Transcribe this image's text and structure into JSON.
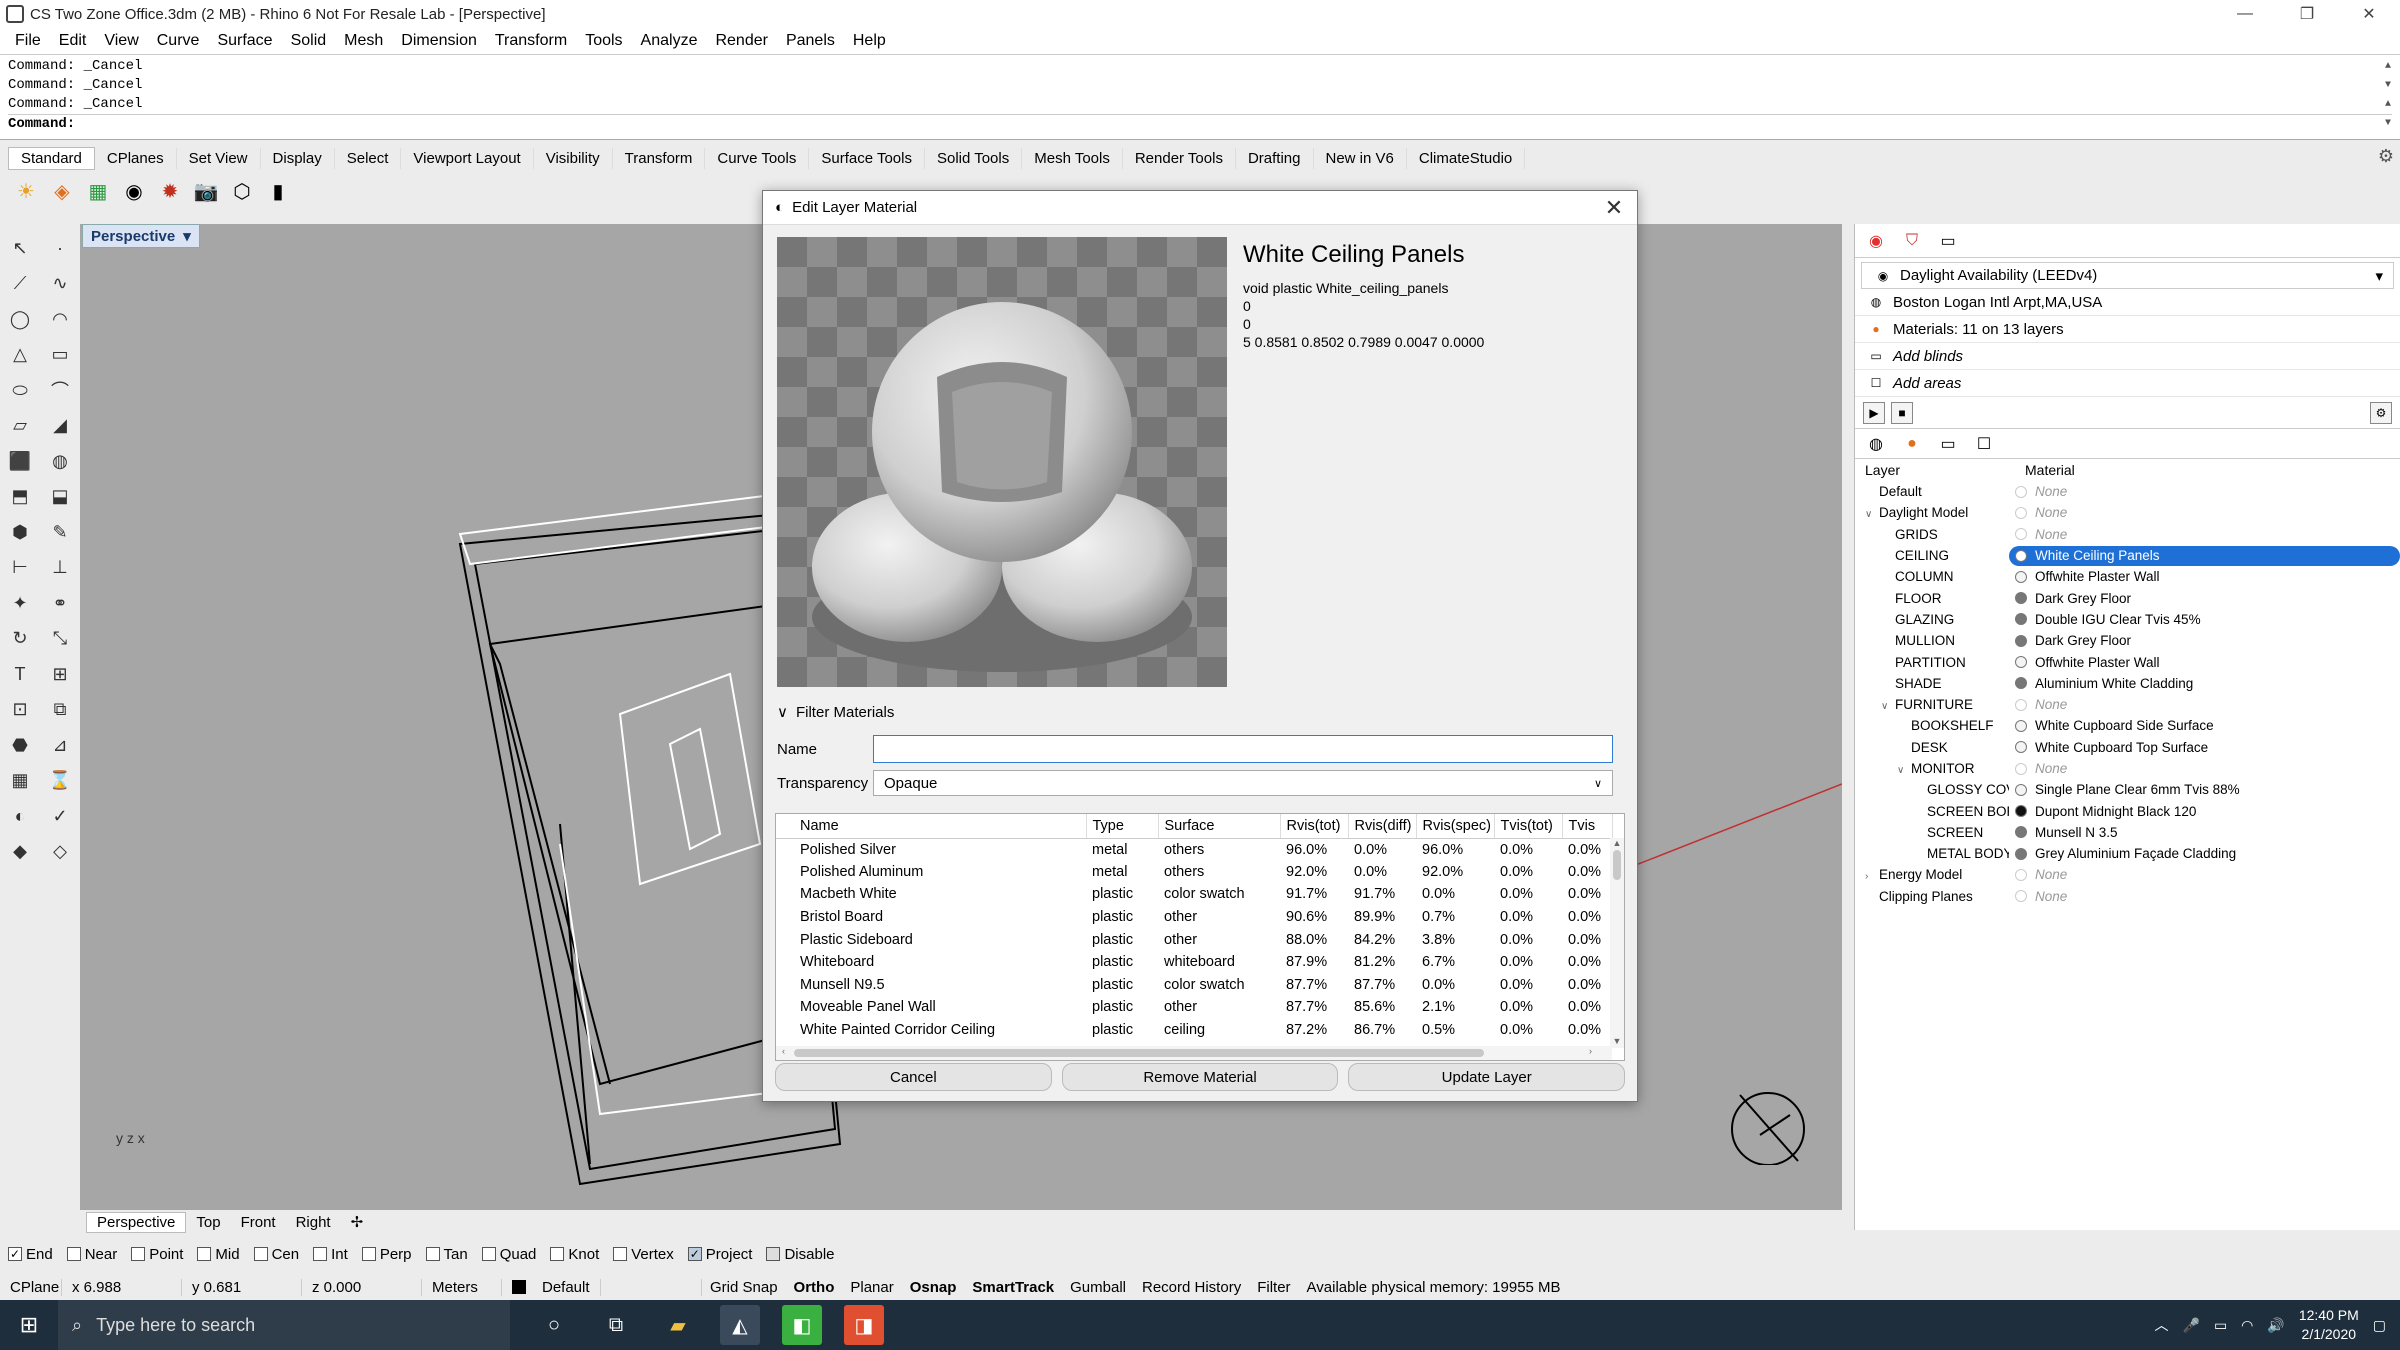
{
  "window": {
    "title": "CS Two Zone Office.3dm (2 MB) - Rhino 6 Not For Resale Lab - [Perspective]",
    "controls": [
      "—",
      "❐",
      "✕"
    ]
  },
  "menu": [
    "File",
    "Edit",
    "View",
    "Curve",
    "Surface",
    "Solid",
    "Mesh",
    "Dimension",
    "Transform",
    "Tools",
    "Analyze",
    "Render",
    "Panels",
    "Help"
  ],
  "command_history": [
    "Command: _Cancel",
    "Command: _Cancel",
    "Command: _Cancel",
    "Command:"
  ],
  "toolbar_tabs": [
    "Standard",
    "CPlanes",
    "Set View",
    "Display",
    "Select",
    "Viewport Layout",
    "Visibility",
    "Transform",
    "Curve Tools",
    "Surface Tools",
    "Solid Tools",
    "Mesh Tools",
    "Render Tools",
    "Drafting",
    "New in V6",
    "ClimateStudio"
  ],
  "viewport": {
    "label": "Perspective",
    "tabs": [
      "Perspective",
      "Top",
      "Front",
      "Right"
    ],
    "axis": "y z x"
  },
  "osnap": [
    "End",
    "Near",
    "Point",
    "Mid",
    "Cen",
    "Int",
    "Perp",
    "Tan",
    "Quad",
    "Knot",
    "Vertex",
    "Project",
    "Disable"
  ],
  "osnap_checked": [
    "End",
    "Project"
  ],
  "status": {
    "cplane": "CPlane",
    "x": "x 6.988",
    "y": "y 0.681",
    "z": "z 0.000",
    "units": "Meters",
    "layer": "Default",
    "toggles": [
      "Grid Snap",
      "Ortho",
      "Planar",
      "Osnap",
      "SmartTrack",
      "Gumball",
      "Record History",
      "Filter"
    ],
    "memory": "Available physical memory: 19955 MB"
  },
  "taskbar": {
    "search_placeholder": "Type here to search",
    "time": "12:40 PM",
    "date": "2/1/2020"
  },
  "climate_panel": {
    "metric": "Daylight Availability (LEEDv4)",
    "rows": [
      {
        "icon": "globe-icon",
        "label": "Boston Logan Intl Arpt,MA,USA",
        "italic": false
      },
      {
        "icon": "material-icon",
        "label": "Materials: 11 on 13 layers",
        "italic": false
      },
      {
        "icon": "blinds-icon",
        "label": "Add blinds",
        "italic": true
      },
      {
        "icon": "area-icon",
        "label": "Add areas",
        "italic": true
      }
    ],
    "layer_header": [
      "Layer",
      "Material"
    ],
    "layers": [
      {
        "name": "Default",
        "indent": 0,
        "material": "None",
        "mat_type": "none"
      },
      {
        "name": "Daylight Model",
        "indent": 0,
        "expand": "v",
        "material": "None",
        "mat_type": "none"
      },
      {
        "name": "GRIDS",
        "indent": 1,
        "material": "None",
        "mat_type": "none"
      },
      {
        "name": "CEILING",
        "indent": 1,
        "material": "White Ceiling Panels",
        "mat_type": "selected"
      },
      {
        "name": "COLUMN",
        "indent": 1,
        "material": "Offwhite Plaster Wall",
        "mat_type": "light"
      },
      {
        "name": "FLOOR",
        "indent": 1,
        "material": "Dark Grey Floor",
        "mat_type": "grey"
      },
      {
        "name": "GLAZING",
        "indent": 1,
        "material": "Double IGU Clear Tvis 45%",
        "mat_type": "grey"
      },
      {
        "name": "MULLION",
        "indent": 1,
        "material": "Dark Grey Floor",
        "mat_type": "grey"
      },
      {
        "name": "PARTITION",
        "indent": 1,
        "material": "Offwhite Plaster Wall",
        "mat_type": "light"
      },
      {
        "name": "SHADE",
        "indent": 1,
        "material": "Aluminium White Cladding",
        "mat_type": "grey"
      },
      {
        "name": "FURNITURE",
        "indent": 1,
        "expand": "v",
        "material": "None",
        "mat_type": "none"
      },
      {
        "name": "BOOKSHELF",
        "indent": 2,
        "material": "White Cupboard Side Surface",
        "mat_type": "light"
      },
      {
        "name": "DESK",
        "indent": 2,
        "material": "White Cupboard Top Surface",
        "mat_type": "light"
      },
      {
        "name": "MONITOR",
        "indent": 2,
        "expand": "v",
        "material": "None",
        "mat_type": "none"
      },
      {
        "name": "GLOSSY COVE",
        "indent": 3,
        "material": "Single Plane Clear 6mm Tvis 88%",
        "mat_type": "light"
      },
      {
        "name": "SCREEN BORD",
        "indent": 3,
        "material": "Dupont Midnight Black 120",
        "mat_type": "black"
      },
      {
        "name": "SCREEN",
        "indent": 3,
        "material": "Munsell N 3.5",
        "mat_type": "grey"
      },
      {
        "name": "METAL BODY",
        "indent": 3,
        "material": "Grey Aluminium Façade Cladding",
        "mat_type": "grey"
      },
      {
        "name": "Energy Model",
        "indent": 0,
        "expand": ">",
        "material": "None",
        "mat_type": "none"
      },
      {
        "name": "Clipping Planes",
        "indent": 0,
        "material": "None",
        "mat_type": "none"
      }
    ]
  },
  "dialog": {
    "title": "Edit Layer Material",
    "material_name": "White Ceiling Panels",
    "definition": [
      "void plastic White_ceiling_panels",
      "0",
      "0",
      "5 0.8581 0.8502 0.7989 0.0047 0.0000"
    ],
    "filter_label": "Filter Materials",
    "name_label": "Name",
    "name_value": "",
    "transparency_label": "Transparency",
    "transparency_value": "Opaque",
    "columns": [
      "Name",
      "Type",
      "Surface",
      "Rvis(tot)",
      "Rvis(diff)",
      "Rvis(spec)",
      "Tvis(tot)",
      "Tvis"
    ],
    "rows": [
      [
        "Polished Silver",
        "metal",
        "others",
        "96.0%",
        "0.0%",
        "96.0%",
        "0.0%",
        "0.0%"
      ],
      [
        "Polished Aluminum",
        "metal",
        "others",
        "92.0%",
        "0.0%",
        "92.0%",
        "0.0%",
        "0.0%"
      ],
      [
        "Macbeth White",
        "plastic",
        "color swatch",
        "91.7%",
        "91.7%",
        "0.0%",
        "0.0%",
        "0.0%"
      ],
      [
        "Bristol Board",
        "plastic",
        "other",
        "90.6%",
        "89.9%",
        "0.7%",
        "0.0%",
        "0.0%"
      ],
      [
        "Plastic Sideboard",
        "plastic",
        "other",
        "88.0%",
        "84.2%",
        "3.8%",
        "0.0%",
        "0.0%"
      ],
      [
        "Whiteboard",
        "plastic",
        "whiteboard",
        "87.9%",
        "81.2%",
        "6.7%",
        "0.0%",
        "0.0%"
      ],
      [
        "Munsell N9.5",
        "plastic",
        "color swatch",
        "87.7%",
        "87.7%",
        "0.0%",
        "0.0%",
        "0.0%"
      ],
      [
        "Moveable Panel Wall",
        "plastic",
        "other",
        "87.7%",
        "85.6%",
        "2.1%",
        "0.0%",
        "0.0%"
      ],
      [
        "White Painted Corridor Ceiling",
        "plastic",
        "ceiling",
        "87.2%",
        "86.7%",
        "0.5%",
        "0.0%",
        "0.0%"
      ]
    ],
    "buttons": {
      "cancel": "Cancel",
      "remove": "Remove Material",
      "update": "Update Layer"
    }
  },
  "colors": {
    "accent": "#1e6fd6",
    "viewport_bg": "#a6a6a6",
    "taskbar": "#1f2e3c"
  }
}
